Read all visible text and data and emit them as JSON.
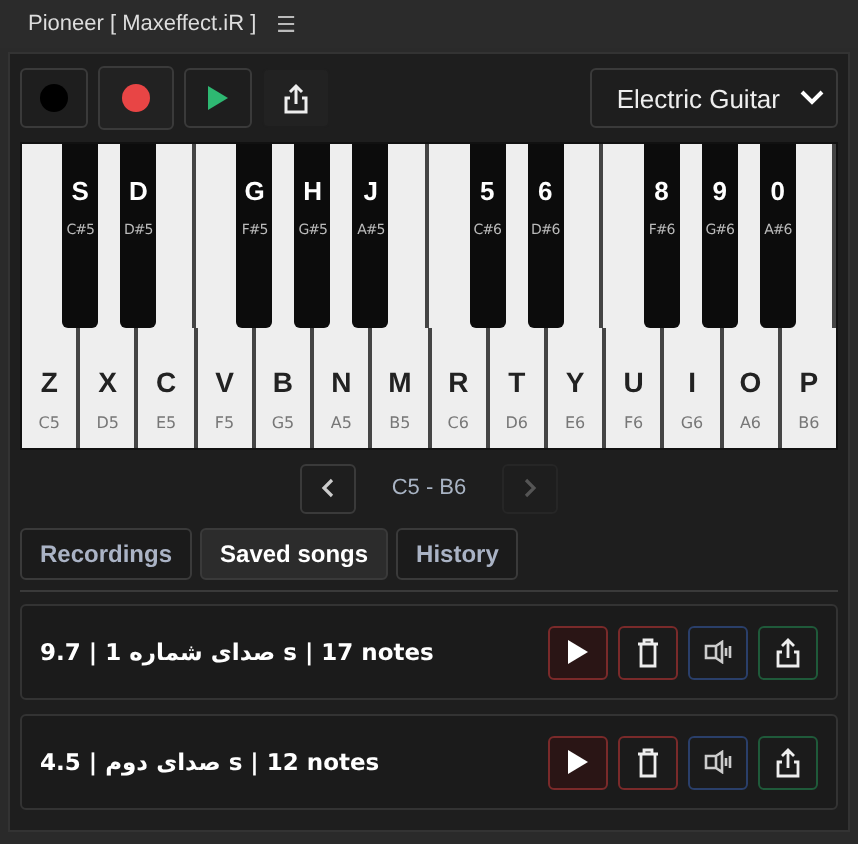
{
  "window": {
    "title": "Pioneer [ Maxeffect.iR ]",
    "menu_icon": "☰"
  },
  "toolbar": {
    "instrument": "Electric Guitar"
  },
  "piano": {
    "white_keys": [
      {
        "key": "Z",
        "note": "C5",
        "black": {
          "key": "S",
          "note": "C#5"
        }
      },
      {
        "key": "X",
        "note": "D5",
        "black": {
          "key": "D",
          "note": "D#5"
        }
      },
      {
        "key": "C",
        "note": "E5"
      },
      {
        "key": "V",
        "note": "F5",
        "black": {
          "key": "G",
          "note": "F#5"
        }
      },
      {
        "key": "B",
        "note": "G5",
        "black": {
          "key": "H",
          "note": "G#5"
        }
      },
      {
        "key": "N",
        "note": "A5",
        "black": {
          "key": "J",
          "note": "A#5"
        }
      },
      {
        "key": "M",
        "note": "B5"
      },
      {
        "key": "R",
        "note": "C6",
        "black": {
          "key": "5",
          "note": "C#6"
        }
      },
      {
        "key": "T",
        "note": "D6",
        "black": {
          "key": "6",
          "note": "D#6"
        }
      },
      {
        "key": "Y",
        "note": "E6"
      },
      {
        "key": "U",
        "note": "F6",
        "black": {
          "key": "8",
          "note": "F#6"
        }
      },
      {
        "key": "I",
        "note": "G6",
        "black": {
          "key": "9",
          "note": "G#6"
        }
      },
      {
        "key": "O",
        "note": "A6",
        "black": {
          "key": "0",
          "note": "A#6"
        }
      },
      {
        "key": "P",
        "note": "B6"
      }
    ]
  },
  "range": {
    "label": "C5 - B6",
    "prev_disabled": false,
    "next_disabled": true
  },
  "tabs": [
    {
      "label": "Recordings",
      "selected": false
    },
    {
      "label": "Saved songs",
      "selected": true
    },
    {
      "label": "History",
      "selected": false
    }
  ],
  "songs": [
    {
      "text": "صدای شماره 1 | 9.7 s | 17 notes"
    },
    {
      "text": "صدای دوم | 4.5 s | 12 notes"
    }
  ]
}
